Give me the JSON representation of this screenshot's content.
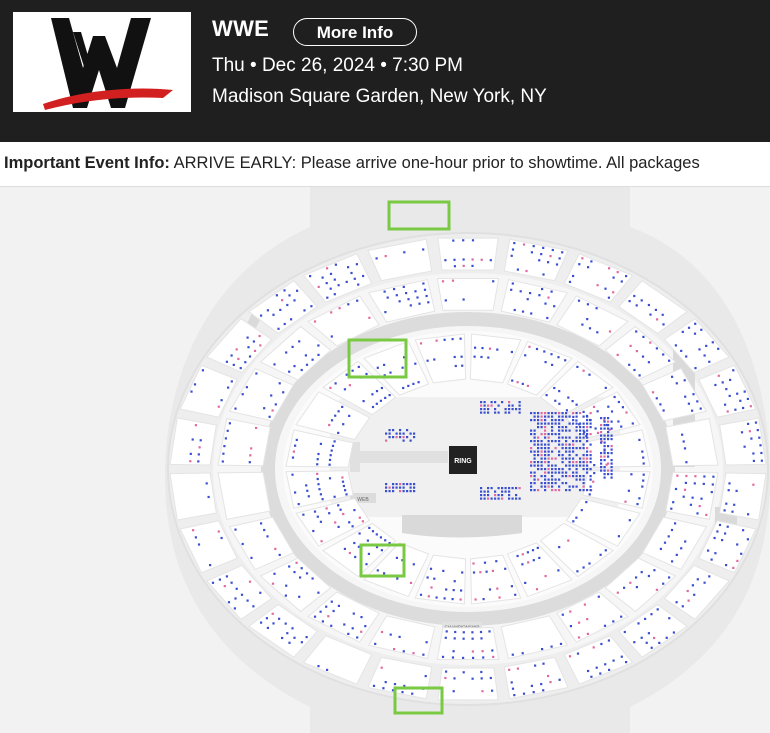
{
  "event": {
    "title": "WWE",
    "more_info_label": "More Info",
    "date_line": "Thu • Dec 26, 2024 • 7:30 PM",
    "venue_line": "Madison Square Garden, New York, NY",
    "logo_icon": "wwe-logo-icon"
  },
  "info_bar": {
    "label": "Important Event Info:",
    "text": "ARRIVE EARLY: Please arrive one-hour prior to showtime. All packages"
  },
  "seat_map": {
    "stage_label": "RING",
    "side_label": "WEB",
    "lower_tag": "CHAMPIONSHIP",
    "colors": {
      "available_seat": "#3a4fd0",
      "resale_seat": "#e06aa0",
      "highlight": "#7ac943",
      "section": "#ffffff",
      "ring": "#222222"
    }
  }
}
